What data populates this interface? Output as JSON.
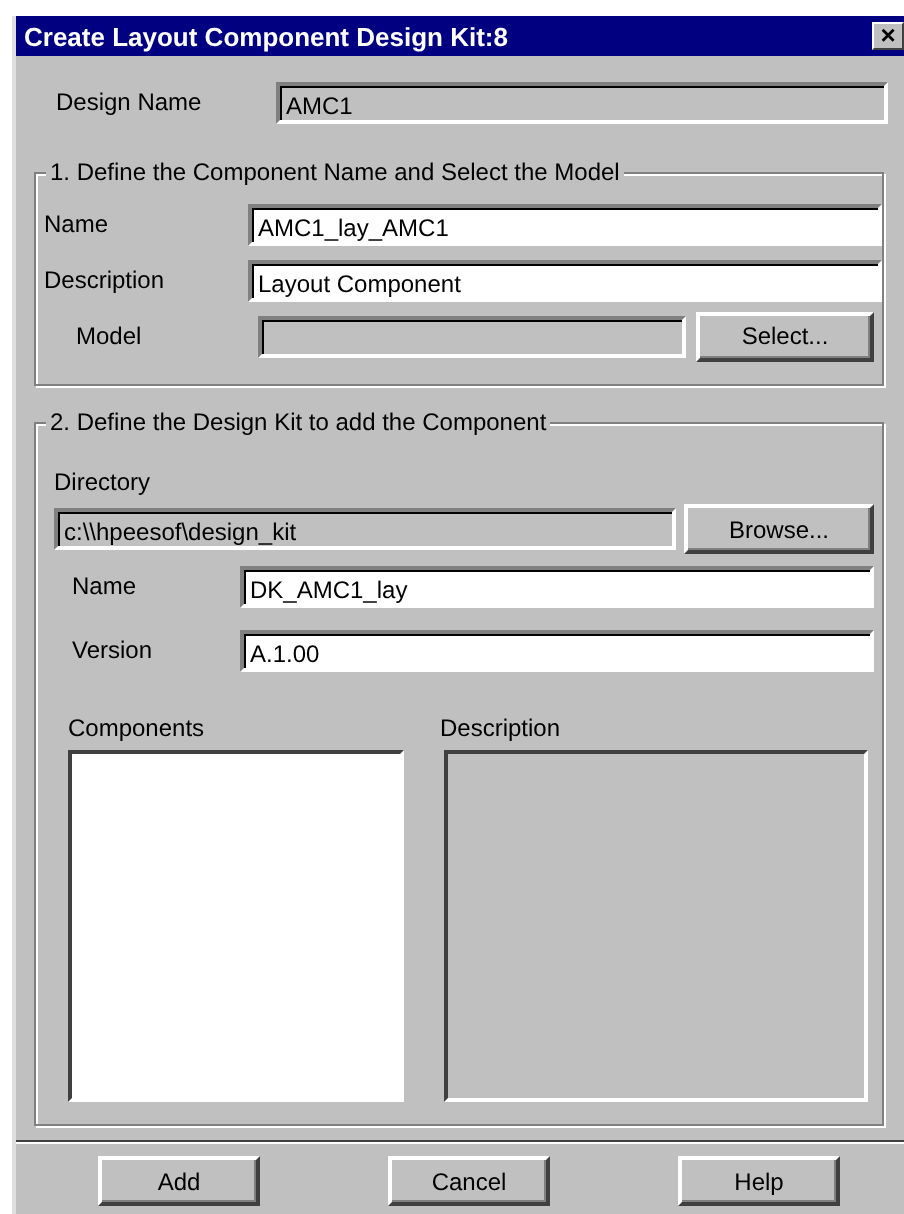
{
  "window": {
    "title": "Create Layout Component Design Kit:8",
    "close": "×"
  },
  "design_name": {
    "label": "Design Name",
    "value": "AMC1",
    "disabled": true
  },
  "group1": {
    "legend": "1. Define the Component Name and Select the Model",
    "fields": [
      {
        "label": "Name",
        "value": "AMC1_lay_AMC1",
        "disabled": false
      },
      {
        "label": "Description",
        "value": "Layout Component",
        "disabled": false
      }
    ],
    "model": {
      "label": "Model",
      "disabled": true,
      "button": "Select..."
    }
  },
  "group2": {
    "legend": "2. Define the Design Kit to add the Component",
    "directory": {
      "label": "Directory",
      "value": "c:\\\\hpeesof\\design_kit",
      "disabled": true,
      "button": "Browse..."
    },
    "fields": [
      {
        "label": "Name",
        "value": "DK_AMC1_lay",
        "disabled": false
      },
      {
        "label": "Version",
        "value": "A.1.00",
        "disabled": false
      }
    ],
    "components": {
      "label": "Components",
      "disabled": false
    },
    "description": {
      "label": "Description",
      "disabled": true
    }
  },
  "buttons": [
    "Add",
    "Cancel",
    "Help"
  ]
}
